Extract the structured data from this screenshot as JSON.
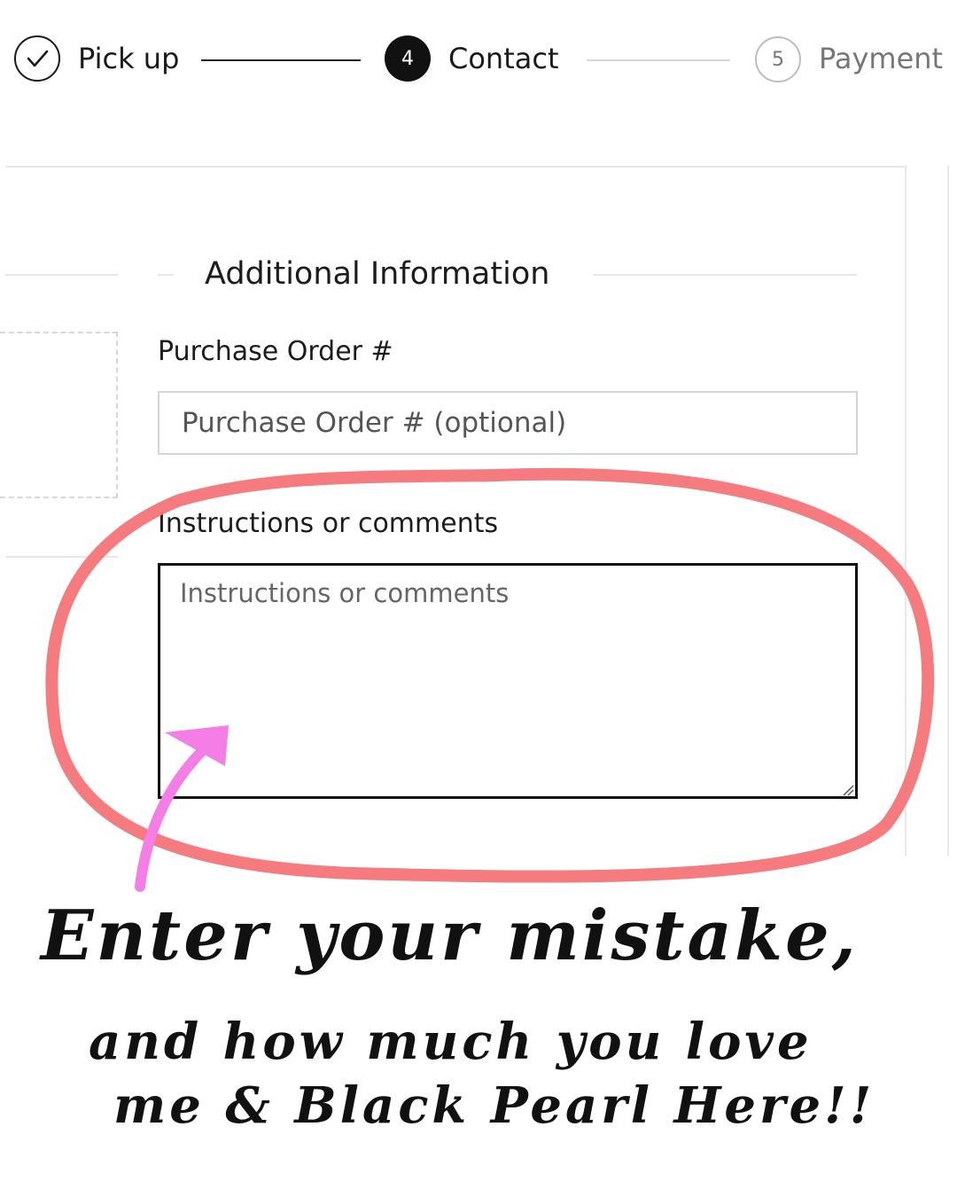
{
  "stepper": {
    "steps": [
      {
        "label": "Pick up",
        "state": "done",
        "icon": "check-icon"
      },
      {
        "label": "Contact",
        "state": "active",
        "number": "4"
      },
      {
        "label": "Payment",
        "state": "todo",
        "number": "5"
      }
    ]
  },
  "form": {
    "section_title": "Additional Information",
    "po_label": "Purchase Order #",
    "po_placeholder": "Purchase Order # (optional)",
    "po_value": "",
    "comments_label": "Instructions or comments",
    "comments_placeholder": "Instructions or comments",
    "comments_value": ""
  },
  "annotation": {
    "line1": "Enter your mistake,",
    "line2": "and how much you love",
    "line3": "me & Black Pearl Here!!",
    "circle_color": "#f47478",
    "arrow_color": "#f47de6"
  }
}
